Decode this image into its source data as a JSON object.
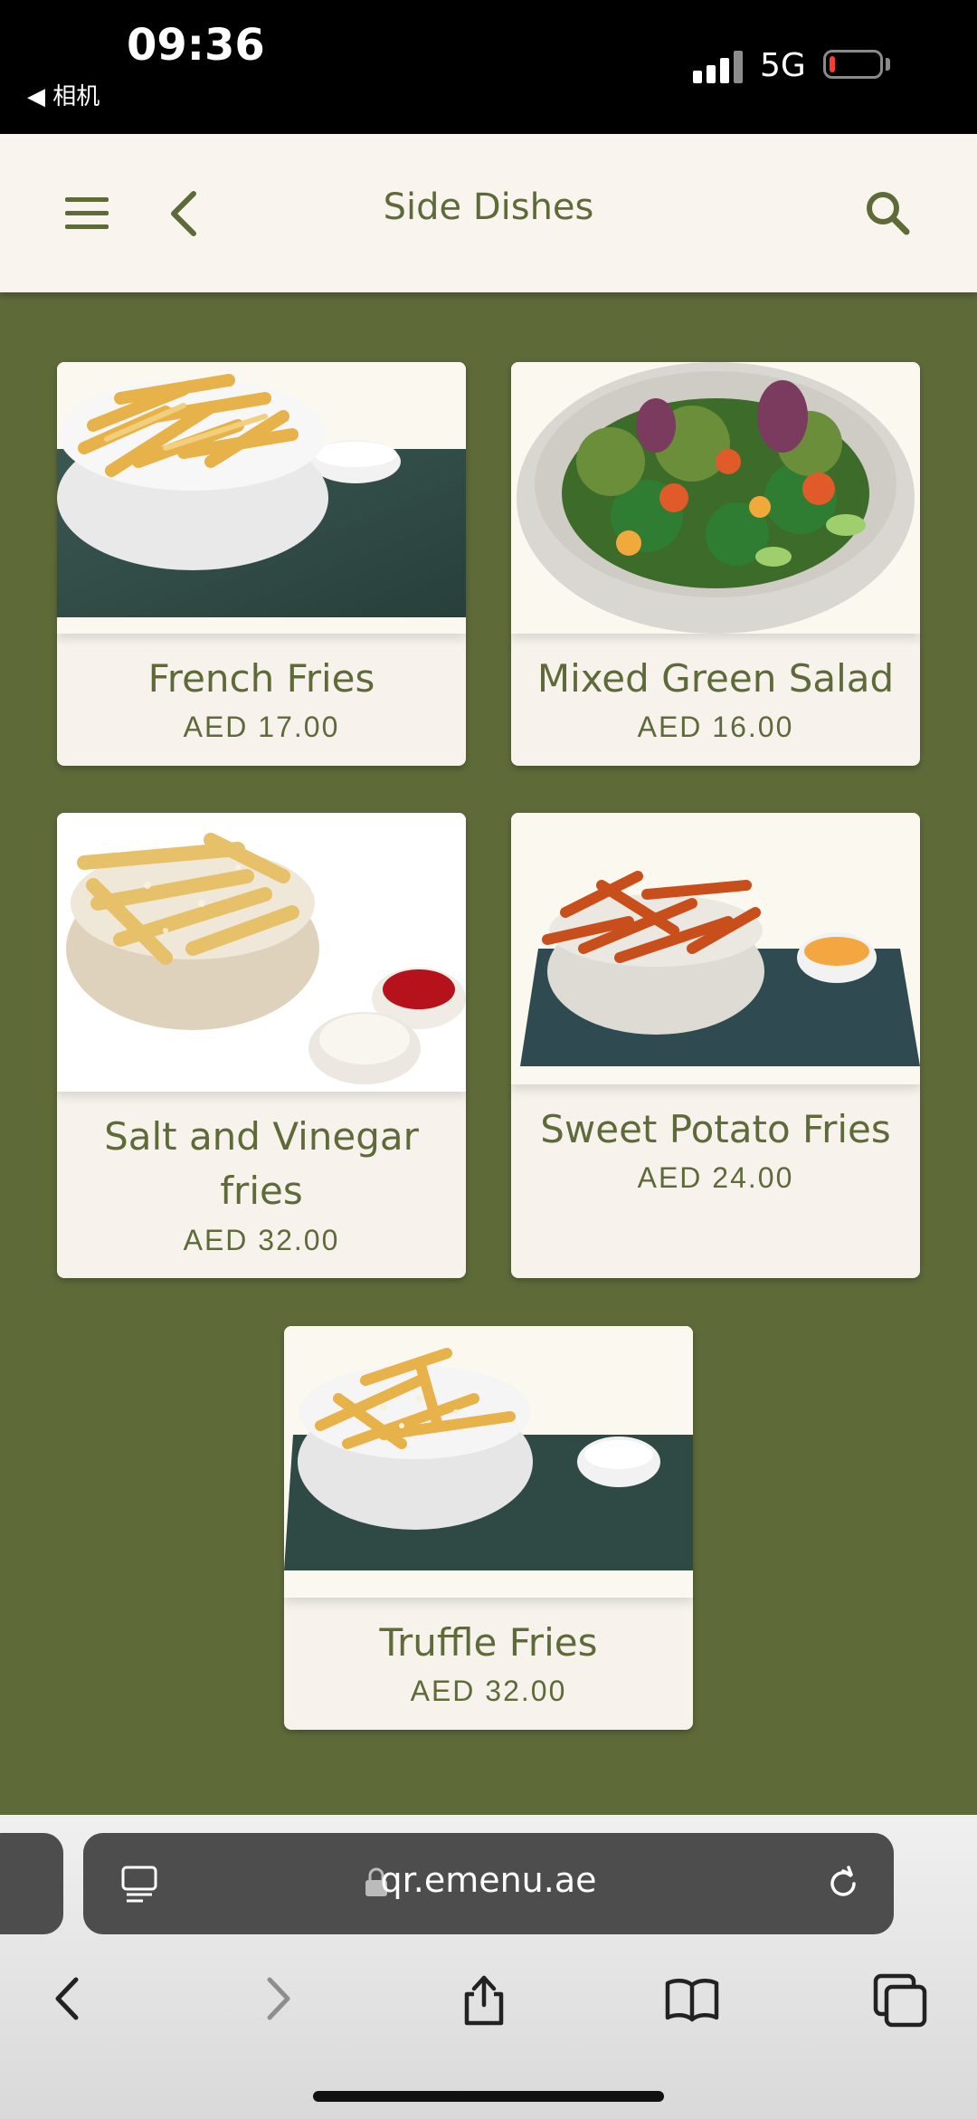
{
  "status_bar": {
    "time": "09:36",
    "back_app": "◀ 相机",
    "network": "5G",
    "battery_fraction": 0.12
  },
  "header": {
    "title": "Side Dishes"
  },
  "menu_items": [
    {
      "name": "French Fries",
      "price": "AED 17.00"
    },
    {
      "name": "Mixed Green Salad",
      "price": "AED 16.00"
    },
    {
      "name": "Salt and Vinegar fries",
      "price": "AED 32.00"
    },
    {
      "name": "Sweet Potato Fries",
      "price": "AED 24.00"
    },
    {
      "name": "Truffle Fries",
      "price": "AED 32.00"
    }
  ],
  "browser": {
    "url": "qr.emenu.ae"
  },
  "icons": [
    "hamburger-icon",
    "back-chevron-icon",
    "search-icon",
    "reader-icon",
    "lock-icon",
    "reload-icon",
    "back-icon",
    "forward-icon",
    "share-icon",
    "bookmarks-icon",
    "tabs-icon"
  ],
  "colors": {
    "page_background": "#5e6b39",
    "header_background": "#f9f5ee",
    "card_background": "#f7f3ec",
    "accent": "#5e6b39"
  }
}
